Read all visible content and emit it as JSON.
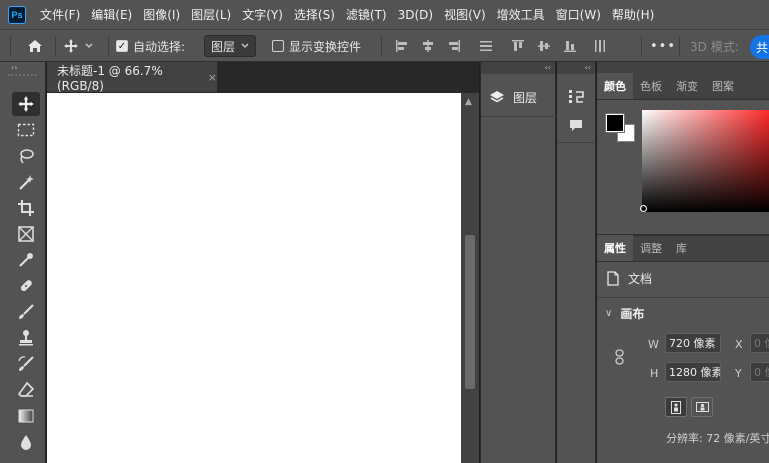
{
  "app": {
    "logo": "Ps"
  },
  "menu": [
    "文件(F)",
    "编辑(E)",
    "图像(I)",
    "图层(L)",
    "文字(Y)",
    "选择(S)",
    "滤镜(T)",
    "3D(D)",
    "视图(V)",
    "增效工具",
    "窗口(W)",
    "帮助(H)"
  ],
  "options": {
    "auto_select_label": "自动选择:",
    "auto_select_checked": true,
    "auto_select_value": "图层",
    "show_transform_label": "显示变换控件",
    "show_transform_checked": false,
    "more_label": "•••",
    "mode_3d_label": "3D 模式:",
    "blue_button_label": "共"
  },
  "toolbar": {
    "collapse_label": "››",
    "tools": [
      "move-tool",
      "marquee-tool",
      "lasso-tool",
      "magic-wand-tool",
      "crop-tool",
      "frame-tool",
      "eyedropper-tool",
      "healing-brush-tool",
      "brush-tool",
      "clone-stamp-tool",
      "history-brush-tool",
      "eraser-tool",
      "gradient-tool",
      "blur-tool"
    ],
    "active_tool": "move-tool"
  },
  "document": {
    "tab_label": "未标题-1 @ 66.7%(RGB/8)",
    "close_label": "×"
  },
  "panels": {
    "col1_collapse": "‹‹",
    "col2_collapse": "‹‹",
    "layers_label": "图层",
    "color_tabs": [
      "颜色",
      "色板",
      "渐变",
      "图案"
    ],
    "color_active": "颜色",
    "props_tabs": [
      "属性",
      "调整",
      "库"
    ],
    "props_active": "属性",
    "doc_label": "文档",
    "canvas_section": "画布",
    "width_label": "W",
    "width_value": "720 像素",
    "height_label": "H",
    "height_value": "1280 像素",
    "x_label": "X",
    "x_value": "0 像",
    "y_label": "Y",
    "y_value": "0 像",
    "resolution_text": "分辨率: 72 像素/英寸"
  },
  "colors": {
    "foreground": "#000000",
    "background": "#ffffff",
    "picker_hue": "#ff2a2a",
    "accent": "#1473e6"
  }
}
